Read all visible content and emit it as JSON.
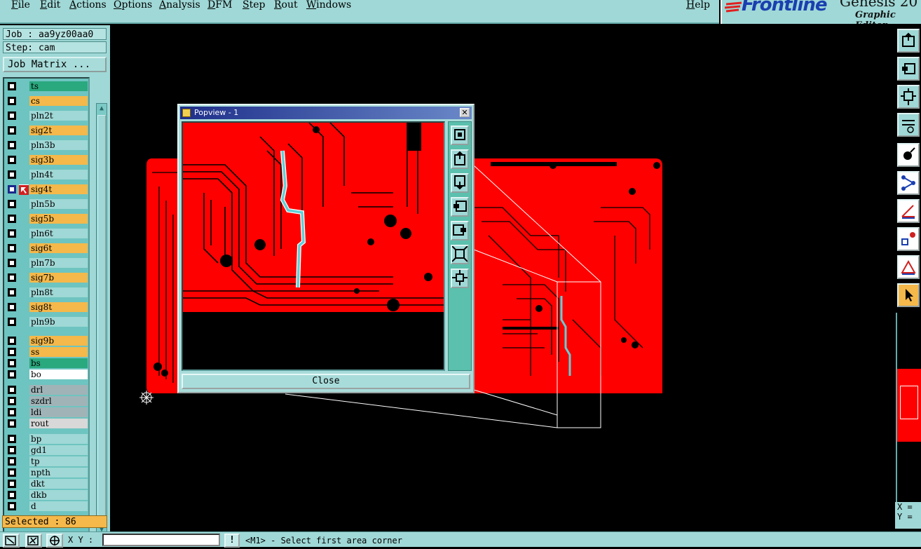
{
  "menu": {
    "items": [
      "File",
      "Edit",
      "Actions",
      "Options",
      "Analysis",
      "DFM",
      "Step",
      "Rout",
      "Windows"
    ],
    "help": "Help"
  },
  "brand": {
    "logo": "Frontline",
    "product": "Genesis 20",
    "subtitle": "Graphic Editor"
  },
  "job_panel": {
    "job": "Job : aa9yz00aa0",
    "step": "Step: cam",
    "job_matrix_button": "Job Matrix ...",
    "selected": "Selected : 86"
  },
  "layers": [
    {
      "name": "ts",
      "color": "#2aa87e"
    },
    {
      "name": "cs",
      "color": "#f5b84a"
    },
    {
      "name": "pln2t",
      "color": "#9fd8d6"
    },
    {
      "name": "sig2t",
      "color": "#f5b84a"
    },
    {
      "name": "pln3b",
      "color": "#9fd8d6"
    },
    {
      "name": "sig3b",
      "color": "#f5b84a"
    },
    {
      "name": "pln4t",
      "color": "#9fd8d6"
    },
    {
      "name": "sig4t",
      "color": "#f5b84a",
      "work": true
    },
    {
      "name": "pln5b",
      "color": "#9fd8d6"
    },
    {
      "name": "sig5b",
      "color": "#f5b84a"
    },
    {
      "name": "pln6t",
      "color": "#9fd8d6"
    },
    {
      "name": "sig6t",
      "color": "#f5b84a"
    },
    {
      "name": "pln7b",
      "color": "#9fd8d6"
    },
    {
      "name": "sig7b",
      "color": "#f5b84a"
    },
    {
      "name": "pln8t",
      "color": "#9fd8d6"
    },
    {
      "name": "sig8t",
      "color": "#f5b84a"
    },
    {
      "name": "pln9b",
      "color": "#9fd8d6"
    },
    {
      "name": "sig9b",
      "color": "#f5b84a"
    },
    {
      "name": "ss",
      "color": "#f5b84a"
    },
    {
      "name": "bs",
      "color": "#2aa87e"
    },
    {
      "name": "bo",
      "color": "#ffffff"
    },
    {
      "name": "drl",
      "color": "#a0b4b8"
    },
    {
      "name": "szdrl",
      "color": "#a0b4b8"
    },
    {
      "name": "ldi",
      "color": "#a0b4b8"
    },
    {
      "name": "rout",
      "color": "#d8d8d8"
    },
    {
      "name": "bp",
      "color": "#9fd8d6"
    },
    {
      "name": "gd1",
      "color": "#9fd8d6"
    },
    {
      "name": "tp",
      "color": "#9fd8d6"
    },
    {
      "name": "npth",
      "color": "#9fd8d6"
    },
    {
      "name": "dkt",
      "color": "#9fd8d6"
    },
    {
      "name": "dkb",
      "color": "#9fd8d6"
    },
    {
      "name": "d",
      "color": "#9fd8d6"
    }
  ],
  "popview": {
    "title": "Popview - 1",
    "close_label": "Close"
  },
  "coords": {
    "x_label": "X =",
    "y_label": "Y ="
  },
  "bottom": {
    "xy_label": "X Y :",
    "xy_value": "",
    "bang": "!",
    "status": "<M1> - Select first area corner"
  },
  "colors": {
    "panel": "#9fd8d6",
    "board": "#ff0000",
    "highlight": "#5fd0d8",
    "selected_bg": "#f5b84a"
  }
}
